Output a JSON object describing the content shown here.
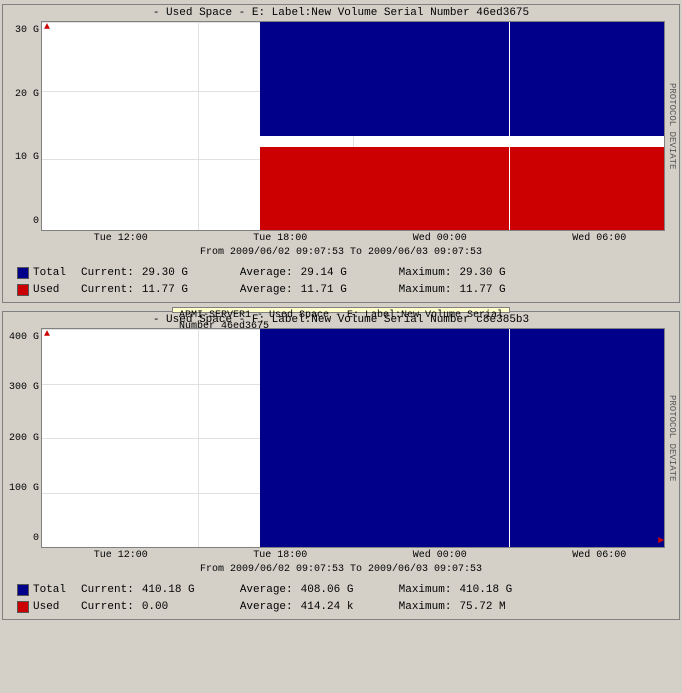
{
  "panel1": {
    "title": " - Used Space - E: Label:New Volume Serial Number 46ed3675",
    "right_label": "PROTOCOL DEVIATE",
    "y_axis": [
      "30 G",
      "20 G",
      "10 G",
      "0"
    ],
    "x_axis": [
      "Tue 12:00",
      "Tue 18:00",
      "Wed 00:00",
      "Wed 06:00"
    ],
    "date_range": "From 2009/06/02 09:07:53 To 2009/06/03 09:07:53",
    "legend": {
      "total": {
        "color": "#00008b",
        "label": "Total",
        "current_label": "Current:",
        "current_val": "29.30 G",
        "avg_label": "Average:",
        "avg_val": "29.14 G",
        "max_label": "Maximum:",
        "max_val": "29.30 G"
      },
      "used": {
        "color": "#cc0000",
        "label": "Used",
        "current_label": "Current:",
        "current_val": "11.77 G",
        "avg_label": "Average:",
        "avg_val": "11.71 G",
        "max_label": "Maximum:",
        "max_val": "11.77 G"
      }
    }
  },
  "tooltip": {
    "line1": "APMI-SERVER1 - Used Space - E: Label:New Volume Serial",
    "line2": "Number 46ed3675"
  },
  "panel2": {
    "title": " - Used Space - F: Label:New Volume Serial Number c8e385b3",
    "right_label": "PROTOCOL DEVIATE",
    "y_axis": [
      "400 G",
      "300 G",
      "200 G",
      "100 G",
      "0"
    ],
    "x_axis": [
      "Tue 12:00",
      "Tue 18:00",
      "Wed 00:00",
      "Wed 06:00"
    ],
    "date_range": "From 2009/06/02 09:07:53 To 2009/06/03 09:07:53",
    "legend": {
      "total": {
        "color": "#00008b",
        "label": "Total",
        "current_label": "Current:",
        "current_val": "410.18 G",
        "avg_label": "Average:",
        "avg_val": "408.06 G",
        "max_label": "Maximum:",
        "max_val": "410.18 G"
      },
      "used": {
        "color": "#cc0000",
        "label": "Used",
        "current_label": "Current:",
        "current_val": "0.00",
        "avg_label": "Average:",
        "avg_val": "414.24 k",
        "max_label": "Maximum:",
        "max_val": "75.72 M"
      }
    }
  }
}
